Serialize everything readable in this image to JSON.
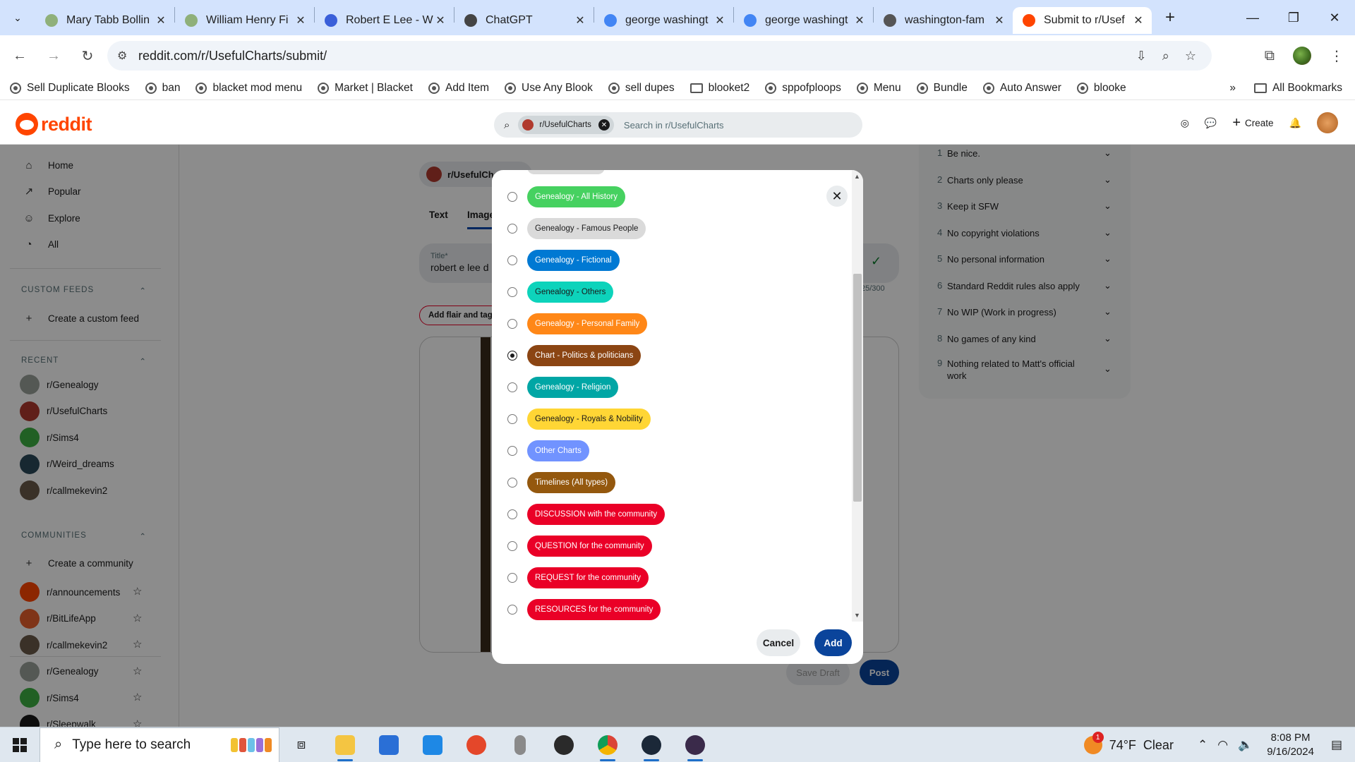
{
  "browser": {
    "tabs": [
      {
        "title": "Mary Tabb Bollin",
        "fav_color": "#8fb07a"
      },
      {
        "title": "William Henry Fi",
        "fav_color": "#8fb07a"
      },
      {
        "title": "Robert E Lee - W",
        "fav_color": "#3a5fd9"
      },
      {
        "title": "ChatGPT",
        "fav_color": "#444444"
      },
      {
        "title": "george washingt",
        "fav_color": "#4285f4"
      },
      {
        "title": "george washingt",
        "fav_color": "#4285f4"
      },
      {
        "title": "washington-fam",
        "fav_color": "#555555"
      },
      {
        "title": "Submit to r/Usef",
        "fav_color": "#ff4500"
      }
    ],
    "url": "reddit.com/r/UsefulCharts/submit/",
    "bookmarks": [
      "Sell Duplicate Blooks",
      "ban",
      "blacket mod menu",
      "Market | Blacket",
      "Add Item",
      "Use Any Blook",
      "sell dupes",
      "blooket2",
      "sppofploops",
      "Menu",
      "Bundle",
      "Auto Answer",
      "blooke"
    ],
    "all_bookmarks": "All Bookmarks",
    "more": "»"
  },
  "reddit": {
    "logo_text": "reddit",
    "search_chip": "r/UsefulCharts",
    "search_placeholder": "Search in r/UsefulCharts",
    "create_label": "Create"
  },
  "sidebar": {
    "nav": [
      "Home",
      "Popular",
      "Explore",
      "All"
    ],
    "custom_feeds_header": "CUSTOM FEEDS",
    "create_custom_feed": "Create a custom feed",
    "recent_header": "RECENT",
    "recent": [
      {
        "name": "r/Genealogy",
        "color": "#9aa09a"
      },
      {
        "name": "r/UsefulCharts",
        "color": "#b03a2e"
      },
      {
        "name": "r/Sims4",
        "color": "#3cb043"
      },
      {
        "name": "r/Weird_dreams",
        "color": "#2a4a5a"
      },
      {
        "name": "r/callmekevin2",
        "color": "#6a5a4a"
      }
    ],
    "communities_header": "COMMUNITIES",
    "create_community": "Create a community",
    "communities": [
      {
        "name": "r/announcements",
        "color": "#ff4500"
      },
      {
        "name": "r/BitLifeApp",
        "color": "#e8602c"
      },
      {
        "name": "r/callmekevin2",
        "color": "#6a5a4a"
      },
      {
        "name": "r/Genealogy",
        "color": "#9aa09a"
      },
      {
        "name": "r/Sims4",
        "color": "#3cb043"
      },
      {
        "name": "r/Sleepwalk",
        "color": "#1a1a1b"
      }
    ]
  },
  "post_form": {
    "community": "r/UsefulCha",
    "tab_text": "Text",
    "tab_image": "Image",
    "title_label": "Title*",
    "title_value": "robert e lee d",
    "char_count": "25/300",
    "flair_button": "Add flair and tags",
    "save_draft": "Save Draft",
    "post": "Post"
  },
  "rules": [
    {
      "n": "1",
      "text": "Be nice."
    },
    {
      "n": "2",
      "text": "Charts only please"
    },
    {
      "n": "3",
      "text": "Keep it SFW"
    },
    {
      "n": "4",
      "text": "No copyright violations"
    },
    {
      "n": "5",
      "text": "No personal information"
    },
    {
      "n": "6",
      "text": "Standard Reddit rules also apply"
    },
    {
      "n": "7",
      "text": "No WIP (Work in progress)"
    },
    {
      "n": "8",
      "text": "No games of any kind"
    },
    {
      "n": "9",
      "text": "Nothing related to Matt's official work"
    }
  ],
  "modal": {
    "flairs": [
      {
        "label": "Genealogy - All History",
        "bg": "#46d160",
        "fg": "#ffffff",
        "selected": false
      },
      {
        "label": "Genealogy - Famous People",
        "bg": "#dadada",
        "fg": "#1a1a1b",
        "selected": false
      },
      {
        "label": "Genealogy - Fictional",
        "bg": "#0079d3",
        "fg": "#ffffff",
        "selected": false
      },
      {
        "label": "Genealogy - Others",
        "bg": "#0dd3bb",
        "fg": "#1a1a1b",
        "selected": false
      },
      {
        "label": "Genealogy - Personal Family",
        "bg": "#ff8717",
        "fg": "#ffffff",
        "selected": false
      },
      {
        "label": "Chart - Politics & politicians",
        "bg": "#8b4513",
        "fg": "#ffffff",
        "selected": true
      },
      {
        "label": "Genealogy - Religion",
        "bg": "#00a6a5",
        "fg": "#ffffff",
        "selected": false
      },
      {
        "label": "Genealogy - Royals & Nobility",
        "bg": "#ffd635",
        "fg": "#1a1a1b",
        "selected": false
      },
      {
        "label": "Other Charts",
        "bg": "#7193ff",
        "fg": "#ffffff",
        "selected": false
      },
      {
        "label": "Timelines (All types)",
        "bg": "#94580e",
        "fg": "#ffffff",
        "selected": false
      },
      {
        "label": "DISCUSSION with the community",
        "bg": "#ea0027",
        "fg": "#ffffff",
        "selected": false
      },
      {
        "label": "QUESTION for the community",
        "bg": "#ea0027",
        "fg": "#ffffff",
        "selected": false
      },
      {
        "label": "REQUEST for the community",
        "bg": "#ea0027",
        "fg": "#ffffff",
        "selected": false
      },
      {
        "label": "RESOURCES for the community",
        "bg": "#ea0027",
        "fg": "#ffffff",
        "selected": false
      }
    ],
    "cancel": "Cancel",
    "add": "Add"
  },
  "taskbar": {
    "search_placeholder": "Type here to search",
    "weather": "74°F  Clear",
    "notif_count": "1",
    "time": "8:08 PM",
    "date": "9/16/2024"
  }
}
